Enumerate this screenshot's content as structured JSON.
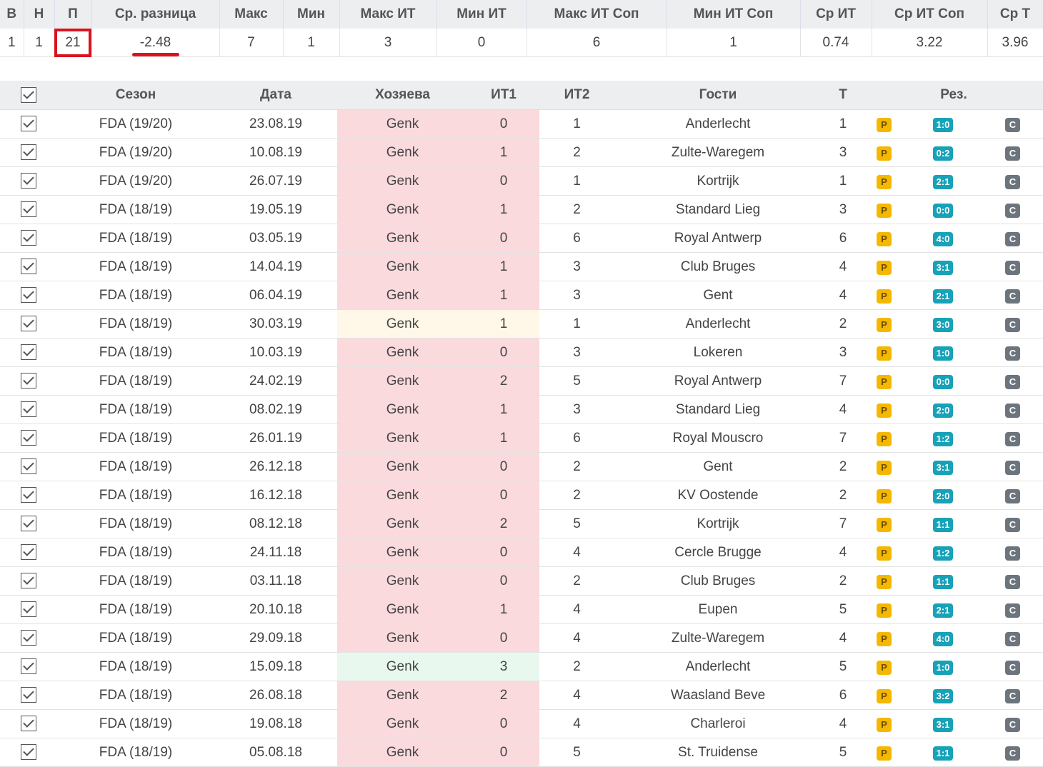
{
  "summary": {
    "headers": [
      "В",
      "Н",
      "П",
      "Ср. разница",
      "Макс",
      "Мин",
      "Макс ИТ",
      "Мин ИТ",
      "Макс ИТ Соп",
      "Мин ИТ Соп",
      "Ср ИТ",
      "Ср ИТ Соп",
      "Ср Т"
    ],
    "values": [
      "1",
      "1",
      "21",
      "-2.48",
      "7",
      "1",
      "3",
      "0",
      "6",
      "1",
      "0.74",
      "3.22",
      "3.96"
    ]
  },
  "table": {
    "headers": {
      "season": "Сезон",
      "date": "Дата",
      "home": "Хозяева",
      "it1": "ИТ1",
      "it2": "ИТ2",
      "away": "Гости",
      "total": "Т",
      "result": "Рез."
    },
    "badge_p": "P",
    "badge_c": "C",
    "colors": {
      "loss": "#fadadd",
      "draw": "#fff8e8",
      "win": "#e8f8ee"
    },
    "rows": [
      {
        "season": "FDA (19/20)",
        "date": "23.08.19",
        "home": "Genk",
        "it1": "0",
        "it2": "1",
        "away": "Anderlecht",
        "total": "1",
        "result": "1:0",
        "outcome": "loss"
      },
      {
        "season": "FDA (19/20)",
        "date": "10.08.19",
        "home": "Genk",
        "it1": "1",
        "it2": "2",
        "away": "Zulte-Waregem",
        "total": "3",
        "result": "0:2",
        "outcome": "loss"
      },
      {
        "season": "FDA (19/20)",
        "date": "26.07.19",
        "home": "Genk",
        "it1": "0",
        "it2": "1",
        "away": "Kortrijk",
        "total": "1",
        "result": "2:1",
        "outcome": "loss"
      },
      {
        "season": "FDA (18/19)",
        "date": "19.05.19",
        "home": "Genk",
        "it1": "1",
        "it2": "2",
        "away": "Standard Lieg",
        "total": "3",
        "result": "0:0",
        "outcome": "loss"
      },
      {
        "season": "FDA (18/19)",
        "date": "03.05.19",
        "home": "Genk",
        "it1": "0",
        "it2": "6",
        "away": "Royal Antwerp",
        "total": "6",
        "result": "4:0",
        "outcome": "loss"
      },
      {
        "season": "FDA (18/19)",
        "date": "14.04.19",
        "home": "Genk",
        "it1": "1",
        "it2": "3",
        "away": "Club Bruges",
        "total": "4",
        "result": "3:1",
        "outcome": "loss"
      },
      {
        "season": "FDA (18/19)",
        "date": "06.04.19",
        "home": "Genk",
        "it1": "1",
        "it2": "3",
        "away": "Gent",
        "total": "4",
        "result": "2:1",
        "outcome": "loss"
      },
      {
        "season": "FDA (18/19)",
        "date": "30.03.19",
        "home": "Genk",
        "it1": "1",
        "it2": "1",
        "away": "Anderlecht",
        "total": "2",
        "result": "3:0",
        "outcome": "draw"
      },
      {
        "season": "FDA (18/19)",
        "date": "10.03.19",
        "home": "Genk",
        "it1": "0",
        "it2": "3",
        "away": "Lokeren",
        "total": "3",
        "result": "1:0",
        "outcome": "loss"
      },
      {
        "season": "FDA (18/19)",
        "date": "24.02.19",
        "home": "Genk",
        "it1": "2",
        "it2": "5",
        "away": "Royal Antwerp",
        "total": "7",
        "result": "0:0",
        "outcome": "loss"
      },
      {
        "season": "FDA (18/19)",
        "date": "08.02.19",
        "home": "Genk",
        "it1": "1",
        "it2": "3",
        "away": "Standard Lieg",
        "total": "4",
        "result": "2:0",
        "outcome": "loss"
      },
      {
        "season": "FDA (18/19)",
        "date": "26.01.19",
        "home": "Genk",
        "it1": "1",
        "it2": "6",
        "away": "Royal Mouscro",
        "total": "7",
        "result": "1:2",
        "outcome": "loss"
      },
      {
        "season": "FDA (18/19)",
        "date": "26.12.18",
        "home": "Genk",
        "it1": "0",
        "it2": "2",
        "away": "Gent",
        "total": "2",
        "result": "3:1",
        "outcome": "loss"
      },
      {
        "season": "FDA (18/19)",
        "date": "16.12.18",
        "home": "Genk",
        "it1": "0",
        "it2": "2",
        "away": "KV Oostende",
        "total": "2",
        "result": "2:0",
        "outcome": "loss"
      },
      {
        "season": "FDA (18/19)",
        "date": "08.12.18",
        "home": "Genk",
        "it1": "2",
        "it2": "5",
        "away": "Kortrijk",
        "total": "7",
        "result": "1:1",
        "outcome": "loss"
      },
      {
        "season": "FDA (18/19)",
        "date": "24.11.18",
        "home": "Genk",
        "it1": "0",
        "it2": "4",
        "away": "Cercle Brugge",
        "total": "4",
        "result": "1:2",
        "outcome": "loss"
      },
      {
        "season": "FDA (18/19)",
        "date": "03.11.18",
        "home": "Genk",
        "it1": "0",
        "it2": "2",
        "away": "Club Bruges",
        "total": "2",
        "result": "1:1",
        "outcome": "loss"
      },
      {
        "season": "FDA (18/19)",
        "date": "20.10.18",
        "home": "Genk",
        "it1": "1",
        "it2": "4",
        "away": "Eupen",
        "total": "5",
        "result": "2:1",
        "outcome": "loss"
      },
      {
        "season": "FDA (18/19)",
        "date": "29.09.18",
        "home": "Genk",
        "it1": "0",
        "it2": "4",
        "away": "Zulte-Waregem",
        "total": "4",
        "result": "4:0",
        "outcome": "loss"
      },
      {
        "season": "FDA (18/19)",
        "date": "15.09.18",
        "home": "Genk",
        "it1": "3",
        "it2": "2",
        "away": "Anderlecht",
        "total": "5",
        "result": "1:0",
        "outcome": "win"
      },
      {
        "season": "FDA (18/19)",
        "date": "26.08.18",
        "home": "Genk",
        "it1": "2",
        "it2": "4",
        "away": "Waasland Beve",
        "total": "6",
        "result": "3:2",
        "outcome": "loss"
      },
      {
        "season": "FDA (18/19)",
        "date": "19.08.18",
        "home": "Genk",
        "it1": "0",
        "it2": "4",
        "away": "Charleroi",
        "total": "4",
        "result": "3:1",
        "outcome": "loss"
      },
      {
        "season": "FDA (18/19)",
        "date": "05.08.18",
        "home": "Genk",
        "it1": "0",
        "it2": "5",
        "away": "St. Truidense",
        "total": "5",
        "result": "1:1",
        "outcome": "loss"
      }
    ]
  }
}
